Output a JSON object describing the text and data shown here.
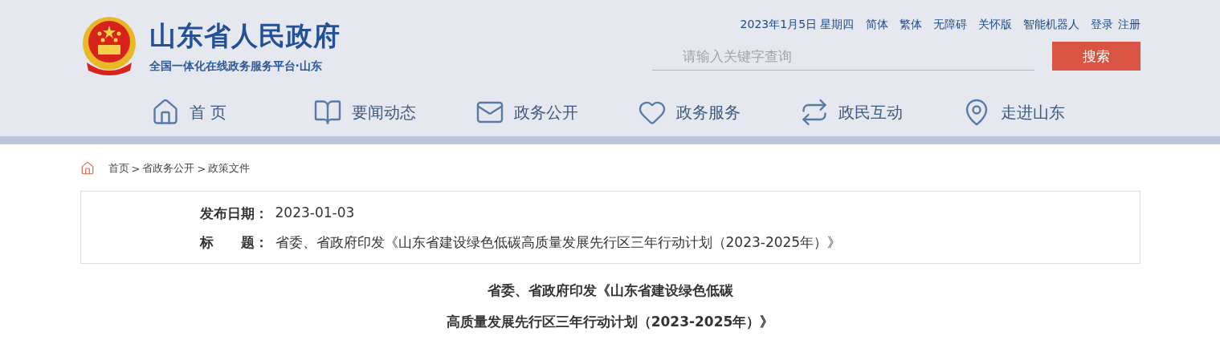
{
  "header": {
    "site_name": "山东省人民政府",
    "subtitle": "全国一体化在线政务服务平台·山东",
    "date": "2023年1月5日 星期四",
    "top_links": [
      "简体",
      "繁体",
      "无障碍",
      "关怀版",
      "智能机器人",
      "登录",
      "注册"
    ],
    "search": {
      "placeholder": "请输入关键字查询",
      "button": "搜索"
    }
  },
  "nav": [
    {
      "label": "首 页"
    },
    {
      "label": "要闻动态"
    },
    {
      "label": "政务公开"
    },
    {
      "label": "政务服务"
    },
    {
      "label": "政民互动"
    },
    {
      "label": "走进山东"
    }
  ],
  "breadcrumb": {
    "items": [
      "首页",
      "省政务公开",
      "政策文件"
    ],
    "separator": ">"
  },
  "info": [
    {
      "label": "发布日期：",
      "value": "2023-01-03"
    },
    {
      "label": "标　　题：",
      "value": "省委、省政府印发《山东省建设绿色低碳高质量发展先行区三年行动计划（2023-2025年）》"
    }
  ],
  "article": {
    "title_lines": [
      "省委、省政府印发《山东省建设绿色低碳",
      "高质量发展先行区三年行动计划（2023-2025年）》"
    ]
  }
}
